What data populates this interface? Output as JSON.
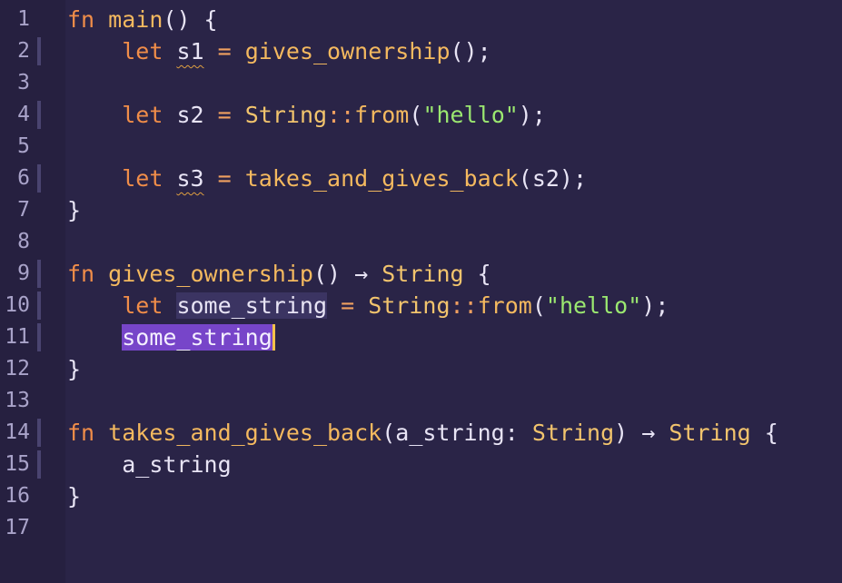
{
  "line_numbers": [
    "1",
    "2",
    "3",
    "4",
    "5",
    "6",
    "7",
    "8",
    "9",
    "10",
    "11",
    "12",
    "13",
    "14",
    "15",
    "16",
    "17"
  ],
  "code": {
    "l1": {
      "kw": "fn",
      "name": "main",
      "rest": "() {"
    },
    "l2": {
      "kw": "let",
      "var": "s1",
      "eq": "=",
      "call": "gives_ownership",
      "rest": "();"
    },
    "l4": {
      "kw": "let",
      "var": "s2",
      "eq": "=",
      "type": "String",
      "sep": "::",
      "call": "from",
      "open": "(",
      "str": "\"hello\"",
      "rest": ");"
    },
    "l6": {
      "kw": "let",
      "var": "s3",
      "eq": "=",
      "call": "takes_and_gives_back",
      "rest": "(s2);"
    },
    "l7": {
      "rest": "}"
    },
    "l9": {
      "kw": "fn",
      "name": "gives_ownership",
      "rest": "()",
      "arrow": "→",
      "type": "String",
      "brace": "{"
    },
    "l10": {
      "kw": "let",
      "var": "some_string",
      "eq": "=",
      "type": "String",
      "sep": "::",
      "call": "from",
      "open": "(",
      "str": "\"hello\"",
      "rest": ");"
    },
    "l11": {
      "ident": "some_string"
    },
    "l12": {
      "rest": "}"
    },
    "l14": {
      "kw": "fn",
      "name": "takes_and_gives_back",
      "open": "(",
      "param": "a_string",
      "colon": ":",
      "type": "String",
      "close": ")",
      "arrow": "→",
      "ret": "String",
      "brace": "{"
    },
    "l15": {
      "ident": "a_string"
    },
    "l16": {
      "rest": "}"
    }
  },
  "colors": {
    "background": "#2a2447",
    "keyword": "#f08d49",
    "function": "#f4b95f",
    "string": "#9be870",
    "selection": "#7745c9",
    "cursor": "#f5c24a"
  }
}
